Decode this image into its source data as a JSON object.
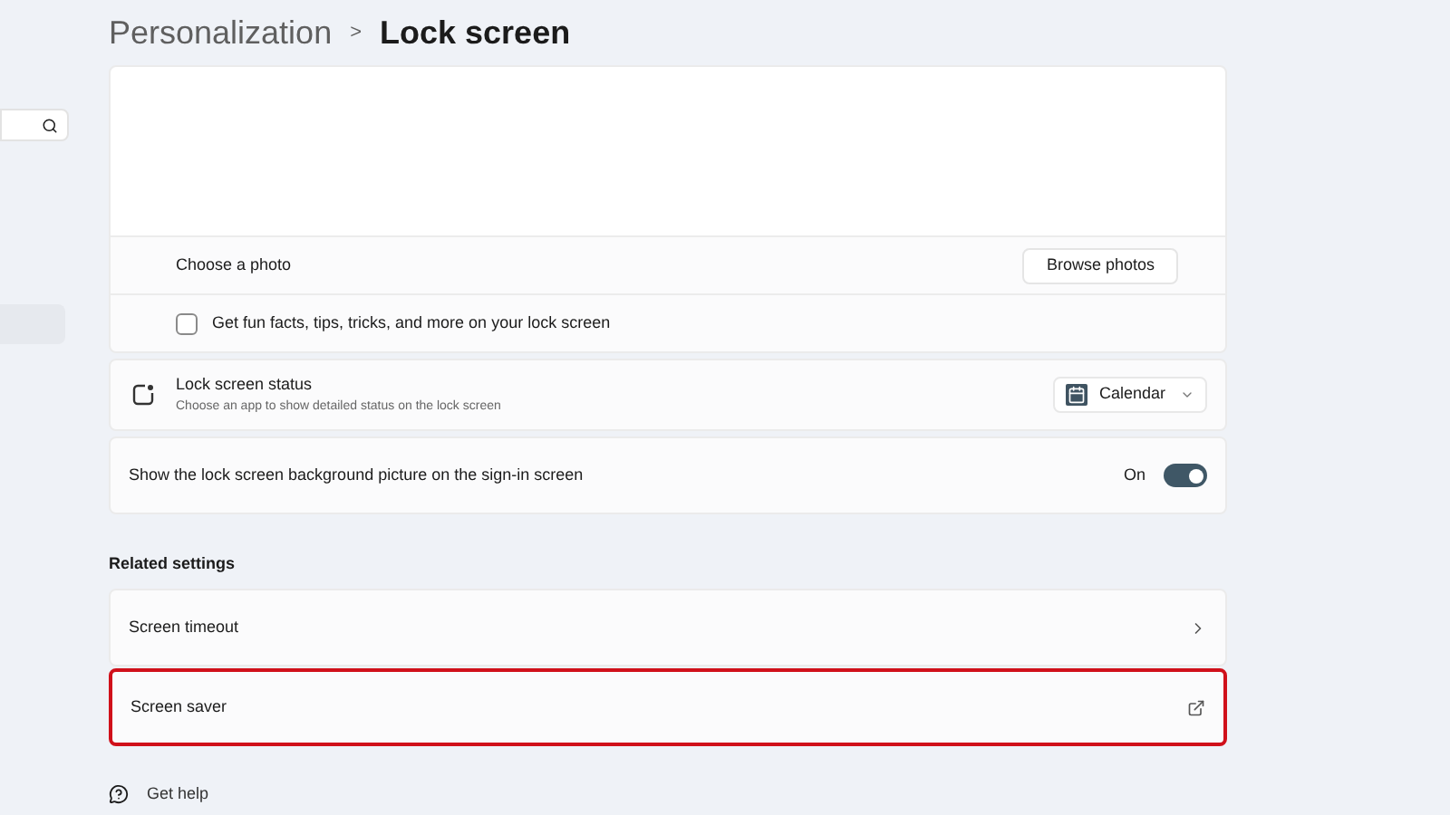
{
  "breadcrumb": {
    "parent": "Personalization",
    "separator": ">",
    "current": "Lock screen"
  },
  "sidebar": {
    "items": [
      {
        "selected": true
      }
    ]
  },
  "photo_card": {
    "choose_label": "Choose a photo",
    "browse_button": "Browse photos",
    "fun_facts": {
      "label": "Get fun facts, tips, tricks, and more on your lock screen",
      "checked": false
    }
  },
  "lock_status": {
    "title": "Lock screen status",
    "description": "Choose an app to show detailed status on the lock screen",
    "dropdown_value": "Calendar"
  },
  "sign_in_background": {
    "label": "Show the lock screen background picture on the sign-in screen",
    "state_label": "On",
    "on": true
  },
  "related_settings": {
    "heading": "Related settings",
    "items": [
      {
        "label": "Screen timeout",
        "kind": "chevron",
        "highlighted": false
      },
      {
        "label": "Screen saver",
        "kind": "external",
        "highlighted": true
      }
    ]
  },
  "help": {
    "label": "Get help"
  }
}
